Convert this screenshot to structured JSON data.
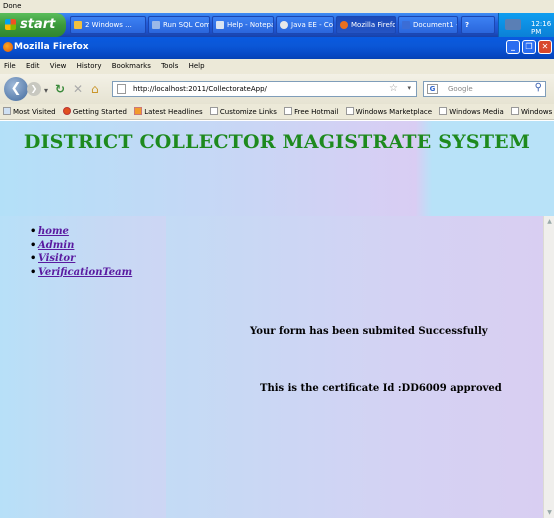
{
  "status": {
    "text": "Done"
  },
  "taskbar": {
    "start_label": "start",
    "tasks": [
      {
        "label": "2 Windows ...",
        "color": "#f0c040"
      },
      {
        "label": "Run SQL Com...",
        "color": "#9bb8e8"
      },
      {
        "label": "Help - Notepad",
        "color": "#d9e4f2"
      },
      {
        "label": "Java EE - Coll...",
        "color": "#e8e8e8"
      },
      {
        "label": "Mozilla Firefox",
        "color": "#e87020"
      },
      {
        "label": "Document1 - ...",
        "color": "#3b6dd6"
      }
    ],
    "tray_time": "12:16 PM"
  },
  "window": {
    "title": "Mozilla Firefox"
  },
  "menu": [
    "File",
    "Edit",
    "View",
    "History",
    "Bookmarks",
    "Tools",
    "Help"
  ],
  "toolbar": {
    "url": "http://localhost:2011/CollectorateApp/",
    "search_placeholder": "Google"
  },
  "bookmarks": [
    {
      "label": "Most Visited",
      "icon": "bookmark-icon"
    },
    {
      "label": "Getting Started",
      "icon": "firefox-icon"
    },
    {
      "label": "Latest Headlines",
      "icon": "rss-icon"
    },
    {
      "label": "Customize Links",
      "icon": "page-icon"
    },
    {
      "label": "Free Hotmail",
      "icon": "page-icon"
    },
    {
      "label": "Windows Marketplace",
      "icon": "page-icon"
    },
    {
      "label": "Windows Media",
      "icon": "page-icon"
    },
    {
      "label": "Windows",
      "icon": "page-icon"
    }
  ],
  "page": {
    "title": "DISTRICT COLLECTOR MAGISTRATE SYSTEM",
    "nav": [
      "home",
      "Admin",
      "Visitor",
      "VerificationTeam"
    ],
    "message_success": "Your form has been submited Successfully",
    "message_certificate": "This is the certificate Id :DD6009 approved"
  },
  "colors": {
    "title_green": "#1e8a1e",
    "link_purple": "#5a1aa0"
  }
}
